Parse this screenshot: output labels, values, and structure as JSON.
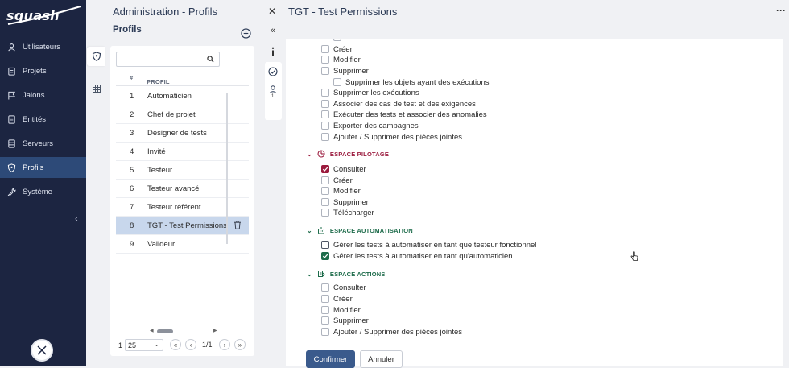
{
  "app": {
    "logo_text": "squash"
  },
  "nav": {
    "items": [
      {
        "label": "Utilisateurs",
        "icon": "user-icon"
      },
      {
        "label": "Projets",
        "icon": "clipboard-icon"
      },
      {
        "label": "Jalons",
        "icon": "flag-icon"
      },
      {
        "label": "Entités",
        "icon": "document-icon"
      },
      {
        "label": "Serveurs",
        "icon": "server-icon"
      },
      {
        "label": "Profils",
        "icon": "shield-icon",
        "active": true
      },
      {
        "label": "Système",
        "icon": "wrench-icon"
      }
    ]
  },
  "admin": {
    "title": "Administration - Profils",
    "section_title": "Profils"
  },
  "table": {
    "search_placeholder": "",
    "columns": {
      "num": "#",
      "name": "PROFIL"
    },
    "rows": [
      {
        "num": "1",
        "name": "Automaticien"
      },
      {
        "num": "2",
        "name": "Chef de projet"
      },
      {
        "num": "3",
        "name": "Designer de tests"
      },
      {
        "num": "4",
        "name": "Invité"
      },
      {
        "num": "5",
        "name": "Testeur"
      },
      {
        "num": "6",
        "name": "Testeur avancé"
      },
      {
        "num": "7",
        "name": "Testeur référent"
      },
      {
        "num": "8",
        "name": "TGT - Test Permissions",
        "selected": true
      },
      {
        "num": "9",
        "name": "Valideur"
      }
    ],
    "pager": {
      "left": "1",
      "page_size": "25",
      "page_info": "1/1"
    }
  },
  "detail": {
    "title": "TGT - Test Permissions",
    "toolbar_badge": "1"
  },
  "permissions": {
    "campaign_items": [
      {
        "label": "Créer",
        "checked": false
      },
      {
        "label": "Modifier",
        "checked": false
      },
      {
        "label": "Supprimer",
        "checked": false
      },
      {
        "label": "Supprimer les objets ayant des exécutions",
        "checked": false,
        "sub": true
      },
      {
        "label": "Supprimer les exécutions",
        "checked": false
      },
      {
        "label": "Associer des cas de test et des exigences",
        "checked": false
      },
      {
        "label": "Exécuter des tests et associer des anomalies",
        "checked": false
      },
      {
        "label": "Exporter des campagnes",
        "checked": false
      },
      {
        "label": "Ajouter / Supprimer des pièces jointes",
        "checked": false
      }
    ],
    "pilotage": {
      "label": "ESPACE PILOTAGE",
      "color": "#9b1b3e",
      "items": [
        {
          "label": "Consulter",
          "checked": true
        },
        {
          "label": "Créer",
          "checked": false
        },
        {
          "label": "Modifier",
          "checked": false
        },
        {
          "label": "Supprimer",
          "checked": false
        },
        {
          "label": "Télécharger",
          "checked": false
        }
      ]
    },
    "automatisation": {
      "label": "ESPACE AUTOMATISATION",
      "color": "#1d6b4a",
      "items": [
        {
          "label": "Gérer les tests à automatiser en tant que testeur fonctionnel",
          "checked": false
        },
        {
          "label": "Gérer les tests à automatiser en tant qu'automaticien",
          "checked": true
        }
      ]
    },
    "actions": {
      "label": "ESPACE ACTIONS",
      "color": "#1d6b4a",
      "items": [
        {
          "label": "Consulter",
          "checked": false
        },
        {
          "label": "Créer",
          "checked": false
        },
        {
          "label": "Modifier",
          "checked": false
        },
        {
          "label": "Supprimer",
          "checked": false
        },
        {
          "label": "Ajouter / Supprimer des pièces jointes",
          "checked": false
        }
      ]
    }
  },
  "buttons": {
    "confirm": "Confirmer",
    "cancel": "Annuler"
  }
}
